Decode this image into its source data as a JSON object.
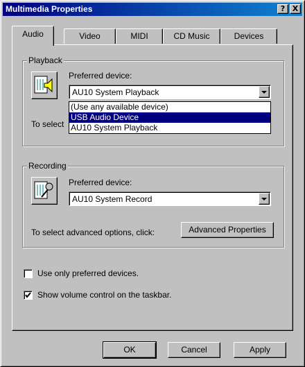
{
  "window": {
    "title": "Multimedia Properties",
    "help_glyph": "?",
    "close_glyph": "X"
  },
  "tabs": [
    {
      "label": "Audio",
      "active": true
    },
    {
      "label": "Video",
      "active": false
    },
    {
      "label": "MIDI",
      "active": false
    },
    {
      "label": "CD Music",
      "active": false
    },
    {
      "label": "Devices",
      "active": false
    }
  ],
  "playback": {
    "group_label": "Playback",
    "icon": "speaker-icon",
    "preferred_label": "Preferred device:",
    "selected": "AU10 System Playback",
    "dropdown_open": true,
    "options": [
      {
        "label": "(Use any available device)",
        "highlighted": false
      },
      {
        "label": "USB Audio Device",
        "highlighted": true
      },
      {
        "label": "AU10 System Playback",
        "highlighted": false
      }
    ],
    "advanced_prompt_partial": "To select"
  },
  "recording": {
    "group_label": "Recording",
    "icon": "microphone-icon",
    "preferred_label": "Preferred device:",
    "selected": "AU10 System Record",
    "advanced_prompt": "To select advanced options, click:",
    "advanced_button": "Advanced Properties"
  },
  "options": {
    "use_preferred_label": "Use only preferred devices.",
    "use_preferred_checked": false,
    "show_volume_label": "Show volume control on the taskbar.",
    "show_volume_checked": true
  },
  "buttons": {
    "ok": "OK",
    "cancel": "Cancel",
    "apply": "Apply"
  },
  "colors": {
    "titlebar_start": "#000080",
    "titlebar_end": "#1084d0",
    "face": "#c0c0c0",
    "highlight": "#000080"
  }
}
